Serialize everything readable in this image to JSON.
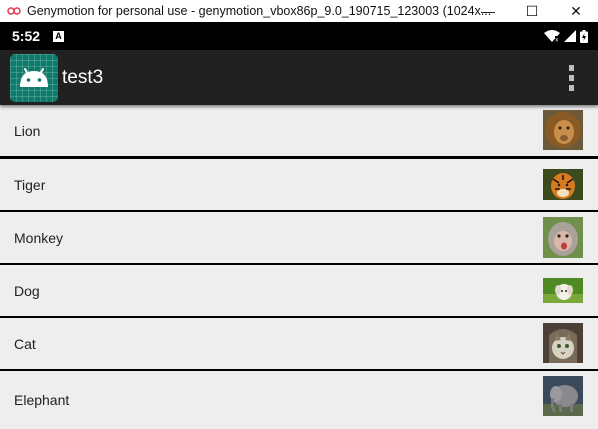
{
  "window": {
    "title": "Genymotion for personal use - genymotion_vbox86p_9.0_190715_123003 (1024x...",
    "minimize_glyph": "—",
    "maximize_glyph": "☐",
    "close_glyph": "✕"
  },
  "statusbar": {
    "time": "5:52",
    "badge": "A",
    "icons": [
      "wifi-icon",
      "signal-icon",
      "battery-icon"
    ]
  },
  "appbar": {
    "title": "test3",
    "logo": "android-icon",
    "menu_icon": "overflow-menu-icon",
    "color": "#212121"
  },
  "list": {
    "items": [
      {
        "label": "Lion",
        "image": "lion-thumbnail"
      },
      {
        "label": "Tiger",
        "image": "tiger-thumbnail"
      },
      {
        "label": "Monkey",
        "image": "monkey-thumbnail"
      },
      {
        "label": "Dog",
        "image": "dog-thumbnail"
      },
      {
        "label": "Cat",
        "image": "cat-thumbnail"
      },
      {
        "label": "Elephant",
        "image": "elephant-thumbnail"
      }
    ]
  },
  "colors": {
    "item_background": "#eeeeee",
    "divider": "#000000",
    "accent": "#0e7a6a"
  }
}
